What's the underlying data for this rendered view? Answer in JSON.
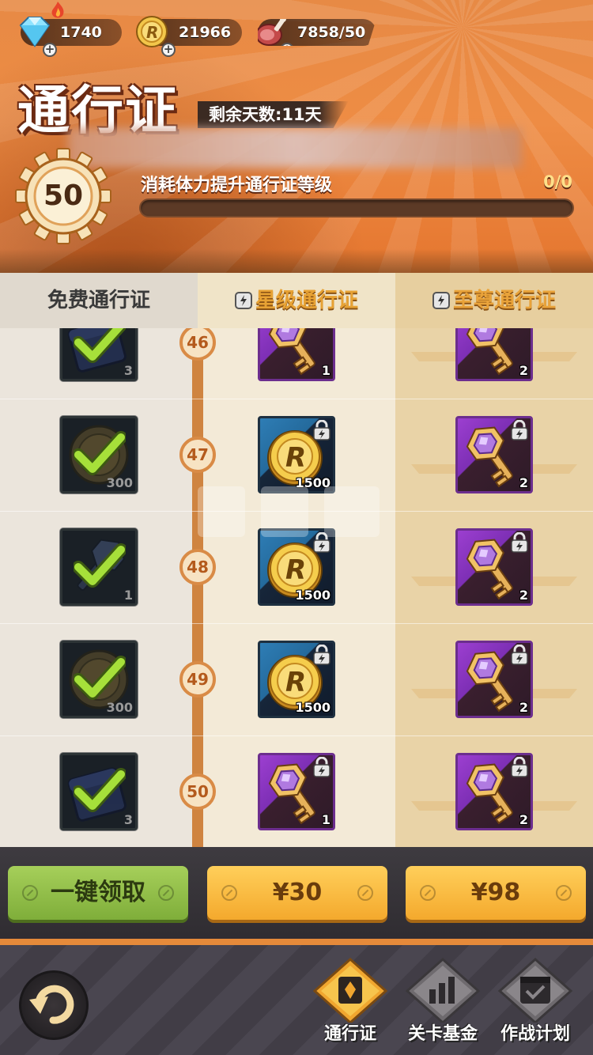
{
  "resources": {
    "diamonds": "1740",
    "coins": "21966",
    "stamina": "7858/50"
  },
  "header": {
    "title": "通行证",
    "days_remaining": "剩余天数:11天",
    "level": "50",
    "progress_label": "消耗体力提升通行证等级",
    "progress_count": "0/0",
    "progress_fraction": 0
  },
  "tabs": {
    "free": "免费通行证",
    "star": "星级通行证",
    "supreme": "至尊通行证"
  },
  "rows": [
    {
      "level": "46",
      "free": {
        "item": "chest",
        "qty": "3",
        "claimed": true
      },
      "star": {
        "item": "purple-key",
        "qty": "1",
        "locked": false
      },
      "supreme": {
        "item": "purple-key",
        "qty": "2",
        "locked": false
      }
    },
    {
      "level": "47",
      "free": {
        "item": "coin",
        "qty": "300",
        "claimed": true
      },
      "star": {
        "item": "gold-coin",
        "qty": "1500",
        "locked": true
      },
      "supreme": {
        "item": "purple-key",
        "qty": "2",
        "locked": true
      }
    },
    {
      "level": "48",
      "free": {
        "item": "key",
        "qty": "1",
        "claimed": true
      },
      "star": {
        "item": "gold-coin",
        "qty": "1500",
        "locked": true
      },
      "supreme": {
        "item": "purple-key",
        "qty": "2",
        "locked": true
      }
    },
    {
      "level": "49",
      "free": {
        "item": "coin",
        "qty": "300",
        "claimed": true
      },
      "star": {
        "item": "gold-coin",
        "qty": "1500",
        "locked": true
      },
      "supreme": {
        "item": "purple-key",
        "qty": "2",
        "locked": true
      }
    },
    {
      "level": "50",
      "free": {
        "item": "chest",
        "qty": "3",
        "claimed": true
      },
      "star": {
        "item": "purple-key",
        "qty": "1",
        "locked": true
      },
      "supreme": {
        "item": "purple-key",
        "qty": "2",
        "locked": true
      }
    }
  ],
  "buttons": {
    "claim_all": "一键领取",
    "buy_star": "¥30",
    "buy_supreme": "¥98"
  },
  "nav": {
    "pass": "通行证",
    "fund": "关卡基金",
    "plan": "作战计划"
  },
  "colors": {
    "header_orange": "#ee8c44",
    "accent_gold": "#f4a92d",
    "claim_green": "#8fbd45"
  }
}
